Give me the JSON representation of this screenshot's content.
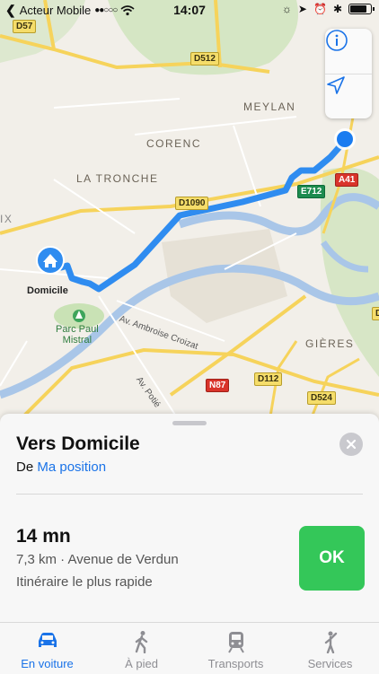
{
  "status_bar": {
    "carrier": "Acteur Mobile",
    "signal": "●●○○○",
    "time": "14:07"
  },
  "map": {
    "places": {
      "meylan": "MEYLAN",
      "corenc": "CORENC",
      "la_tronche": "LA TRONCHE",
      "gieres": "GIÈRES",
      "domicile": "Domicile",
      "parc_line1": "Parc Paul",
      "parc_line2": "Mistral",
      "edge_x": "IX"
    },
    "roads": {
      "d512": "D512",
      "d57": "D57",
      "d1090": "D1090",
      "e712": "E712",
      "a41": "A41",
      "n87": "N87",
      "d112": "D112",
      "d524": "D524",
      "edge_d": "D"
    },
    "streets": {
      "ambroise": "Av. Ambroise Croizat",
      "potie": "Av. Potié"
    },
    "colors": {
      "route": "#2f8cf0",
      "river": "#a9c6e8",
      "location": "#1a7cf0"
    }
  },
  "card": {
    "title": "Vers Domicile",
    "from_prefix": "De",
    "from_link": "Ma position",
    "duration": "14 mn",
    "distance": "7,3 km · Avenue de Verdun",
    "route_type": "Itinéraire le plus rapide",
    "ok_label": "OK",
    "ok_color": "#34c759"
  },
  "tabs": [
    {
      "label": "En voiture",
      "icon": "car-icon",
      "active": true
    },
    {
      "label": "À pied",
      "icon": "walk-icon",
      "active": false
    },
    {
      "label": "Transports",
      "icon": "train-icon",
      "active": false
    },
    {
      "label": "Services",
      "icon": "rideshare-icon",
      "active": false
    }
  ]
}
